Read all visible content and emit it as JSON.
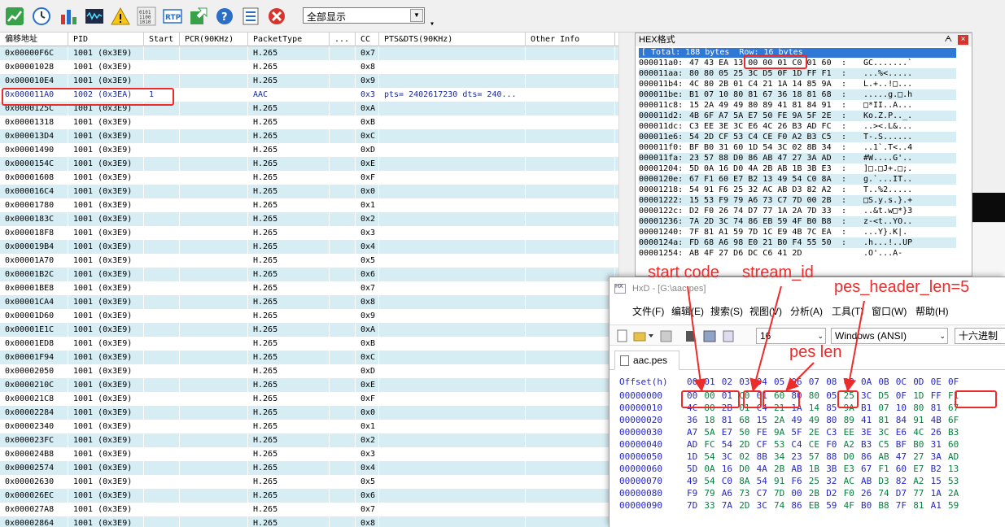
{
  "toolbar": {
    "icons": [
      "chart-trend-icon",
      "clock-icon",
      "bar-chart-icon",
      "waveform-icon",
      "warning-icon",
      "binary-icon",
      "rtp-icon",
      "export-icon",
      "help-icon",
      "list-icon",
      "stop-icon"
    ],
    "rtp_label": "RTP",
    "filter_value": "全部显示",
    "more_glyph": "▾"
  },
  "packets": {
    "headers": [
      "偏移地址",
      "PID",
      "Start",
      "PCR(90KHz)",
      "PacketType",
      "...",
      "CC",
      "PTS&DTS(90KHz)",
      "Other Info"
    ],
    "rows": [
      [
        "0x00000F6C",
        "1001  (0x3E9)",
        "",
        "",
        "H.265",
        "",
        "0x7",
        "",
        ""
      ],
      [
        "0x00001028",
        "1001  (0x3E9)",
        "",
        "",
        "H.265",
        "",
        "0x8",
        "",
        ""
      ],
      [
        "0x000010E4",
        "1001  (0x3E9)",
        "",
        "",
        "H.265",
        "",
        "0x9",
        "",
        ""
      ],
      [
        "0x000011A0",
        "1002  (0x3EA)",
        "1",
        "",
        "AAC",
        "",
        "0x3",
        "pts= 2402617230  dts= 240...",
        ""
      ],
      [
        "0x0000125C",
        "1001  (0x3E9)",
        "",
        "",
        "H.265",
        "",
        "0xA",
        "",
        ""
      ],
      [
        "0x00001318",
        "1001  (0x3E9)",
        "",
        "",
        "H.265",
        "",
        "0xB",
        "",
        ""
      ],
      [
        "0x000013D4",
        "1001  (0x3E9)",
        "",
        "",
        "H.265",
        "",
        "0xC",
        "",
        ""
      ],
      [
        "0x00001490",
        "1001  (0x3E9)",
        "",
        "",
        "H.265",
        "",
        "0xD",
        "",
        ""
      ],
      [
        "0x0000154C",
        "1001  (0x3E9)",
        "",
        "",
        "H.265",
        "",
        "0xE",
        "",
        ""
      ],
      [
        "0x00001608",
        "1001  (0x3E9)",
        "",
        "",
        "H.265",
        "",
        "0xF",
        "",
        ""
      ],
      [
        "0x000016C4",
        "1001  (0x3E9)",
        "",
        "",
        "H.265",
        "",
        "0x0",
        "",
        ""
      ],
      [
        "0x00001780",
        "1001  (0x3E9)",
        "",
        "",
        "H.265",
        "",
        "0x1",
        "",
        ""
      ],
      [
        "0x0000183C",
        "1001  (0x3E9)",
        "",
        "",
        "H.265",
        "",
        "0x2",
        "",
        ""
      ],
      [
        "0x000018F8",
        "1001  (0x3E9)",
        "",
        "",
        "H.265",
        "",
        "0x3",
        "",
        ""
      ],
      [
        "0x000019B4",
        "1001  (0x3E9)",
        "",
        "",
        "H.265",
        "",
        "0x4",
        "",
        ""
      ],
      [
        "0x00001A70",
        "1001  (0x3E9)",
        "",
        "",
        "H.265",
        "",
        "0x5",
        "",
        ""
      ],
      [
        "0x00001B2C",
        "1001  (0x3E9)",
        "",
        "",
        "H.265",
        "",
        "0x6",
        "",
        ""
      ],
      [
        "0x00001BE8",
        "1001  (0x3E9)",
        "",
        "",
        "H.265",
        "",
        "0x7",
        "",
        ""
      ],
      [
        "0x00001CA4",
        "1001  (0x3E9)",
        "",
        "",
        "H.265",
        "",
        "0x8",
        "",
        ""
      ],
      [
        "0x00001D60",
        "1001  (0x3E9)",
        "",
        "",
        "H.265",
        "",
        "0x9",
        "",
        ""
      ],
      [
        "0x00001E1C",
        "1001  (0x3E9)",
        "",
        "",
        "H.265",
        "",
        "0xA",
        "",
        ""
      ],
      [
        "0x00001ED8",
        "1001  (0x3E9)",
        "",
        "",
        "H.265",
        "",
        "0xB",
        "",
        ""
      ],
      [
        "0x00001F94",
        "1001  (0x3E9)",
        "",
        "",
        "H.265",
        "",
        "0xC",
        "",
        ""
      ],
      [
        "0x00002050",
        "1001  (0x3E9)",
        "",
        "",
        "H.265",
        "",
        "0xD",
        "",
        ""
      ],
      [
        "0x0000210C",
        "1001  (0x3E9)",
        "",
        "",
        "H.265",
        "",
        "0xE",
        "",
        ""
      ],
      [
        "0x000021C8",
        "1001  (0x3E9)",
        "",
        "",
        "H.265",
        "",
        "0xF",
        "",
        ""
      ],
      [
        "0x00002284",
        "1001  (0x3E9)",
        "",
        "",
        "H.265",
        "",
        "0x0",
        "",
        ""
      ],
      [
        "0x00002340",
        "1001  (0x3E9)",
        "",
        "",
        "H.265",
        "",
        "0x1",
        "",
        ""
      ],
      [
        "0x000023FC",
        "1001  (0x3E9)",
        "",
        "",
        "H.265",
        "",
        "0x2",
        "",
        ""
      ],
      [
        "0x000024B8",
        "1001  (0x3E9)",
        "",
        "",
        "H.265",
        "",
        "0x3",
        "",
        ""
      ],
      [
        "0x00002574",
        "1001  (0x3E9)",
        "",
        "",
        "H.265",
        "",
        "0x4",
        "",
        ""
      ],
      [
        "0x00002630",
        "1001  (0x3E9)",
        "",
        "",
        "H.265",
        "",
        "0x5",
        "",
        ""
      ],
      [
        "0x000026EC",
        "1001  (0x3E9)",
        "",
        "",
        "H.265",
        "",
        "0x6",
        "",
        ""
      ],
      [
        "0x000027A8",
        "1001  (0x3E9)",
        "",
        "",
        "H.265",
        "",
        "0x7",
        "",
        ""
      ],
      [
        "0x00002864",
        "1001  (0x3E9)",
        "",
        "",
        "H.265",
        "",
        "0x8",
        "",
        ""
      ]
    ]
  },
  "hexpanel": {
    "title": "HEX格式",
    "pin": "ᗅ",
    "close": "×",
    "total": "[ Total: 188 bytes  Row: 16 bytes",
    "rows": [
      [
        "000011a0:",
        "47 43 EA 13 00 00 01 C0 01 60",
        ":",
        "GC.......`"
      ],
      [
        "000011aa:",
        "80 80 05 25 3C D5 0F 1D FF F1",
        ":",
        "...%<....."
      ],
      [
        "000011b4:",
        "4C 80 2B 01 C4 21 1A 14 85 9A",
        ":",
        "L.+..!□..."
      ],
      [
        "000011be:",
        "B1 07 10 80 81 67 36 18 81 68",
        ":",
        ".....g.□.h"
      ],
      [
        "000011c8:",
        "15 2A 49 49 80 89 41 81 84 91",
        ":",
        "□*II..A..."
      ],
      [
        "000011d2:",
        "4B 6F A7 5A E7 50 FE 9A 5F 2E",
        ":",
        "Ko.Z.P.._."
      ],
      [
        "000011dc:",
        "C3 EE 3E 3C E6 4C 26 B3 AD FC",
        ":",
        "..><.L&..."
      ],
      [
        "000011e6:",
        "54 2D CF 53 C4 CE F0 A2 B3 C5",
        ":",
        "T-.S......"
      ],
      [
        "000011f0:",
        "BF B0 31 60 1D 54 3C 02 8B 34",
        ":",
        "..1`.T<..4"
      ],
      [
        "000011fa:",
        "23 57 88 D0 86 AB 47 27 3A AD",
        ":",
        "#W....G'.."
      ],
      [
        "00001204:",
        "5D 0A 16 D0 4A 2B AB 1B 3B E3",
        ":",
        "]□.□J+.□;."
      ],
      [
        "0000120e:",
        "67 F1 60 E7 B2 13 49 54 C0 8A",
        ":",
        "g.`...IT.."
      ],
      [
        "00001218:",
        "54 91 F6 25 32 AC AB D3 82 A2",
        ":",
        "T..%2....."
      ],
      [
        "00001222:",
        "15 53 F9 79 A6 73 C7 7D 00 2B",
        ":",
        "□S.y.s.}.+"
      ],
      [
        "0000122c:",
        "D2 F0 26 74 D7 77 1A 2A 7D 33",
        ":",
        "..&t.w□*}3"
      ],
      [
        "00001236:",
        "7A 2D 3C 74 86 EB 59 4F B0 B8",
        ":",
        "z-<t..YO.."
      ],
      [
        "00001240:",
        "7F 81 A1 59 7D 1C E9 4B 7C EA",
        ":",
        "...Y}.K|."
      ],
      [
        "0000124a:",
        "FD 68 A6 98 E0 21 B0 F4 55 50",
        ":",
        ".h...!..UP"
      ],
      [
        "00001254:",
        "AB 4F 27 D6 DC C6 41 2D",
        "",
        ".O'...A-"
      ]
    ]
  },
  "hxd": {
    "title": "HxD - [G:\\aac.pes]",
    "logo": "HX",
    "menu": [
      "文件(F)",
      "编辑(E)",
      "搜索(S)",
      "视图(V)",
      "分析(A)",
      "工具(T)",
      "窗口(W)",
      "帮助(H)"
    ],
    "bytes_per_row": "16",
    "charset": "Windows (ANSI)",
    "radix": "十六进制",
    "tab": "aac.pes",
    "offset_header": "Offset(h)",
    "col_headers": [
      "00",
      "01",
      "02",
      "03",
      "04",
      "05",
      "06",
      "07",
      "08",
      "09",
      "0A",
      "0B",
      "0C",
      "0D",
      "0E",
      "0F"
    ],
    "rows": [
      [
        "00000000",
        [
          "00",
          "00",
          "01",
          "C0",
          "01",
          "60",
          "80",
          "80",
          "05",
          "25",
          "3C",
          "D5",
          "0F",
          "1D",
          "FF",
          "F1"
        ]
      ],
      [
        "00000010",
        [
          "4C",
          "80",
          "2B",
          "01",
          "C4",
          "21",
          "1A",
          "14",
          "85",
          "9A",
          "B1",
          "07",
          "10",
          "80",
          "81",
          "67"
        ]
      ],
      [
        "00000020",
        [
          "36",
          "18",
          "81",
          "68",
          "15",
          "2A",
          "49",
          "49",
          "80",
          "89",
          "41",
          "81",
          "84",
          "91",
          "4B",
          "6F"
        ]
      ],
      [
        "00000030",
        [
          "A7",
          "5A",
          "E7",
          "50",
          "FE",
          "9A",
          "5F",
          "2E",
          "C3",
          "EE",
          "3E",
          "3C",
          "E6",
          "4C",
          "26",
          "B3"
        ]
      ],
      [
        "00000040",
        [
          "AD",
          "FC",
          "54",
          "2D",
          "CF",
          "53",
          "C4",
          "CE",
          "F0",
          "A2",
          "B3",
          "C5",
          "BF",
          "B0",
          "31",
          "60"
        ]
      ],
      [
        "00000050",
        [
          "1D",
          "54",
          "3C",
          "02",
          "8B",
          "34",
          "23",
          "57",
          "88",
          "D0",
          "86",
          "AB",
          "47",
          "27",
          "3A",
          "AD"
        ]
      ],
      [
        "00000060",
        [
          "5D",
          "0A",
          "16",
          "D0",
          "4A",
          "2B",
          "AB",
          "1B",
          "3B",
          "E3",
          "67",
          "F1",
          "60",
          "E7",
          "B2",
          "13"
        ]
      ],
      [
        "00000070",
        [
          "49",
          "54",
          "C0",
          "8A",
          "54",
          "91",
          "F6",
          "25",
          "32",
          "AC",
          "AB",
          "D3",
          "82",
          "A2",
          "15",
          "53"
        ]
      ],
      [
        "00000080",
        [
          "F9",
          "79",
          "A6",
          "73",
          "C7",
          "7D",
          "00",
          "2B",
          "D2",
          "F0",
          "26",
          "74",
          "D7",
          "77",
          "1A",
          "2A"
        ]
      ],
      [
        "00000090",
        [
          "7D",
          "33",
          "7A",
          "2D",
          "3C",
          "74",
          "86",
          "EB",
          "59",
          "4F",
          "B0",
          "B8",
          "7F",
          "81",
          "A1",
          "59"
        ]
      ]
    ]
  },
  "annotations": {
    "start_code": "start code",
    "stream_id": "stream_id",
    "pes_header_len": "pes_header_len=5",
    "pes_len": "pes len",
    "color": "#ec2b2b"
  }
}
